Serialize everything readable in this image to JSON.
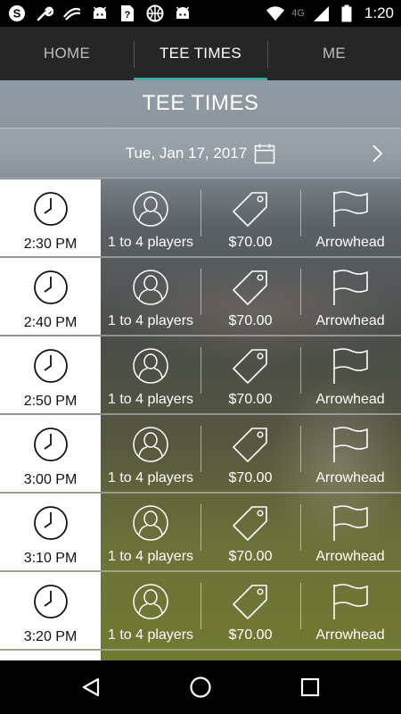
{
  "status_bar": {
    "time": "1:20",
    "network_label": "4G",
    "left_icons": [
      "skype-icon",
      "wrench-icon",
      "signal-app-icon",
      "android-icon",
      "sim-question-icon",
      "basketball-icon",
      "android-icon"
    ],
    "right_icons": [
      "wifi-icon",
      "cellular-icon",
      "battery-icon"
    ]
  },
  "tabs": [
    {
      "label": "HOME",
      "active": false
    },
    {
      "label": "TEE TIMES",
      "active": true
    },
    {
      "label": "ME",
      "active": false
    }
  ],
  "page": {
    "title": "TEE TIMES",
    "date": "Tue, Jan 17, 2017"
  },
  "tee_times": [
    {
      "time": "2:30 PM",
      "players": "1 to 4 players",
      "price": "$70.00",
      "course": "Arrowhead"
    },
    {
      "time": "2:40 PM",
      "players": "1 to 4 players",
      "price": "$70.00",
      "course": "Arrowhead"
    },
    {
      "time": "2:50 PM",
      "players": "1 to 4 players",
      "price": "$70.00",
      "course": "Arrowhead"
    },
    {
      "time": "3:00 PM",
      "players": "1 to 4 players",
      "price": "$70.00",
      "course": "Arrowhead"
    },
    {
      "time": "3:10 PM",
      "players": "1 to 4 players",
      "price": "$70.00",
      "course": "Arrowhead"
    },
    {
      "time": "3:20 PM",
      "players": "1 to 4 players",
      "price": "$70.00",
      "course": "Arrowhead"
    }
  ],
  "colors": {
    "tab_bar": "#262626",
    "active_tab_indicator": "#3fa79b",
    "time_cell_bg": "#ffffff"
  }
}
